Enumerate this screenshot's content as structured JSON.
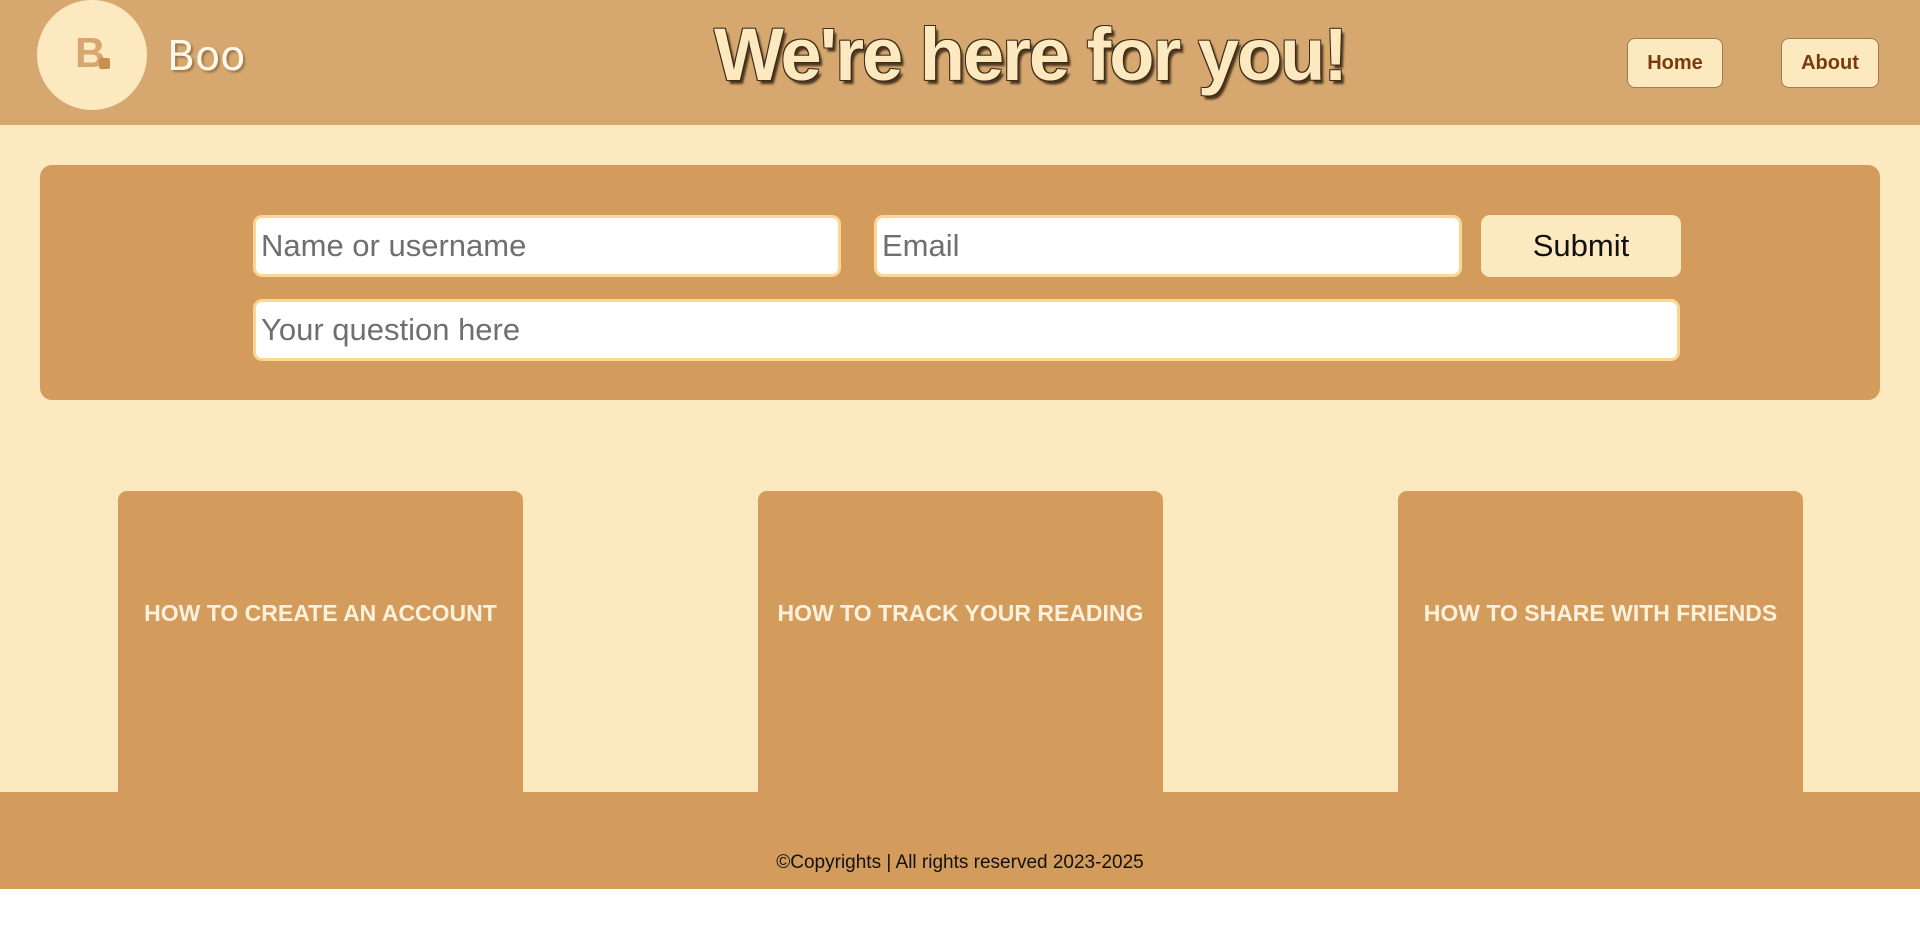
{
  "header": {
    "logo_letter": "B",
    "brand_name": "Boo",
    "title": "We're here for you!",
    "nav": {
      "home_label": "Home",
      "about_label": "About"
    }
  },
  "question_form": {
    "name_placeholder": "Name or username",
    "email_placeholder": "Email",
    "question_placeholder": "Your question here",
    "submit_label": "Submit"
  },
  "help_cards": [
    {
      "label": "HOW TO CREATE AN ACCOUNT"
    },
    {
      "label": "HOW TO TRACK YOUR READING"
    },
    {
      "label": "HOW TO SHARE WITH FRIENDS"
    }
  ],
  "footer": {
    "copyright_text": "©Copyrights | All rights reserved 2023-2025"
  },
  "colors": {
    "header_bg": "#d6a86f",
    "page_bg": "#fde9c0",
    "panel_bg": "#d49c5c",
    "nav_text": "#7a3b0c"
  }
}
